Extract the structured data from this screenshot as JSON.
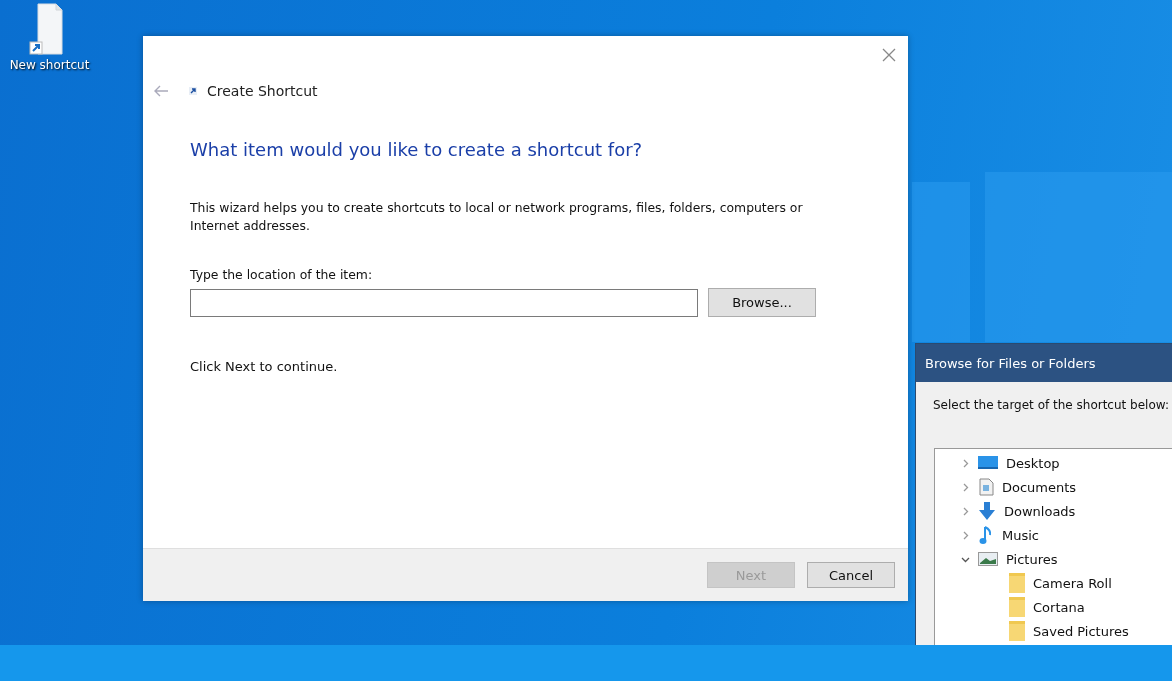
{
  "desktop_icons": [
    {
      "label": "New shortcut"
    }
  ],
  "wizard": {
    "title": "Create Shortcut",
    "heading": "What item would you like to create a shortcut for?",
    "description": "This wizard helps you to create shortcuts to local or network programs, files, folders, computers or Internet addresses.",
    "location_label": "Type the location of the item:",
    "browse_button": "Browse...",
    "hint": "Click Next to continue.",
    "buttons": [
      {
        "label": "Next",
        "disabled": true
      },
      {
        "label": "Cancel",
        "disabled": false
      }
    ]
  },
  "browse_dialog": {
    "title": "Browse for Files or Folders",
    "prompt": "Select the target of the shortcut below:",
    "tree": [
      {
        "label": "Desktop",
        "kind": "desktop",
        "expanded": false
      },
      {
        "label": "Documents",
        "kind": "documents",
        "expanded": false
      },
      {
        "label": "Downloads",
        "kind": "downloads",
        "expanded": false
      },
      {
        "label": "Music",
        "kind": "music",
        "expanded": false
      },
      {
        "label": "Pictures",
        "kind": "pictures",
        "expanded": true,
        "children": [
          {
            "label": "Camera Roll",
            "kind": "folder"
          },
          {
            "label": "Cortana",
            "kind": "folder"
          },
          {
            "label": "Saved Pictures",
            "kind": "folder"
          }
        ]
      }
    ]
  }
}
